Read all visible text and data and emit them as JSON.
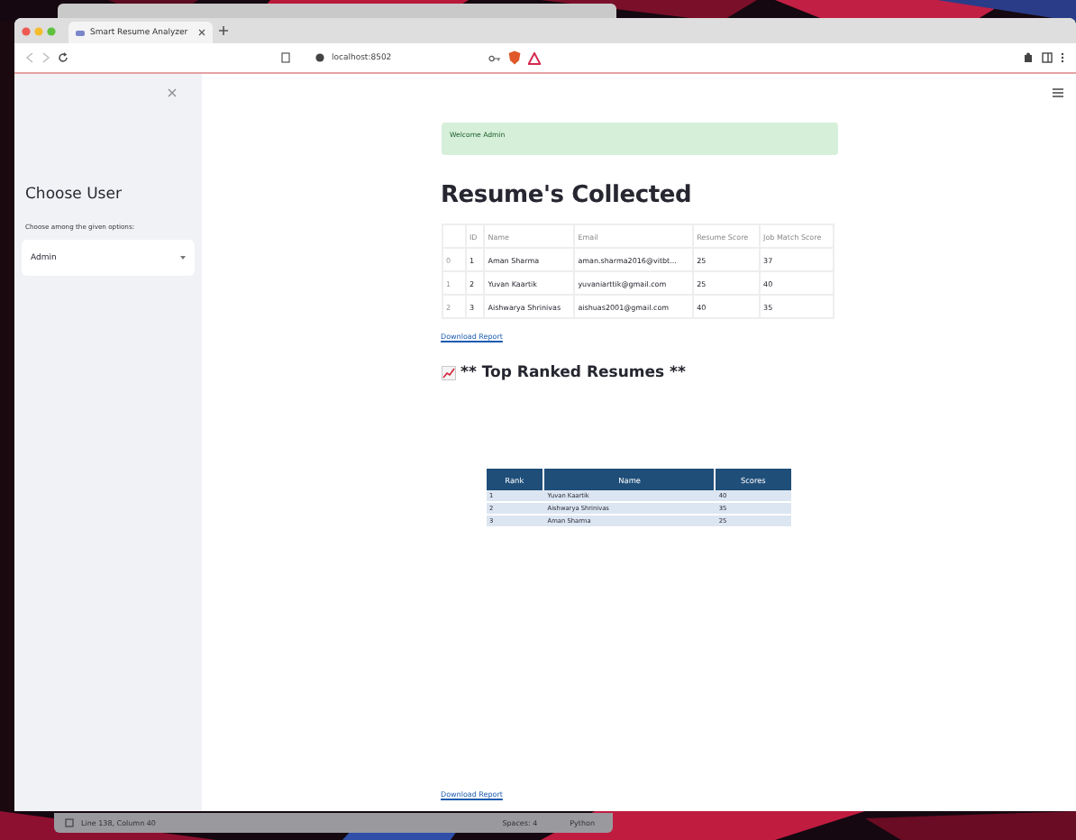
{
  "browser": {
    "tab_title": "Smart Resume Analyzer",
    "address": "localhost:8502"
  },
  "sidebar": {
    "title": "Choose User",
    "prompt": "Choose among the given options:",
    "select_value": "Admin"
  },
  "main": {
    "alert": "Welcome Admin",
    "heading": "Resume's Collected",
    "table": {
      "columns": [
        "ID",
        "Name",
        "Email",
        "Resume Score",
        "Job Match Score"
      ],
      "rows": [
        {
          "index": "0",
          "cells": [
            "1",
            "Aman Sharma",
            "aman.sharma2016@vitbt...",
            "25",
            "37"
          ]
        },
        {
          "index": "1",
          "cells": [
            "2",
            "Yuvan Kaartik",
            "yuvaniarttik@gmail.com",
            "25",
            "40"
          ]
        },
        {
          "index": "2",
          "cells": [
            "3",
            "Aishwarya Shrinivas",
            "aishuas2001@gmail.com",
            "40",
            "35"
          ]
        }
      ]
    },
    "download_link": "Download Report",
    "ranked_heading": "** Top Ranked Resumes **",
    "ranked_table": {
      "columns": [
        "Rank",
        "Name",
        "Scores"
      ],
      "rows": [
        [
          "1",
          "Yuvan Kaartik",
          "40"
        ],
        [
          "2",
          "Aishwarya Shrinivas",
          "35"
        ],
        [
          "3",
          "Aman Sharma",
          "25"
        ]
      ]
    },
    "bottom_link": "Download Report"
  },
  "status_bar": {
    "position": "Line 138, Column 40",
    "indent": "Spaces: 4",
    "language": "Python"
  }
}
